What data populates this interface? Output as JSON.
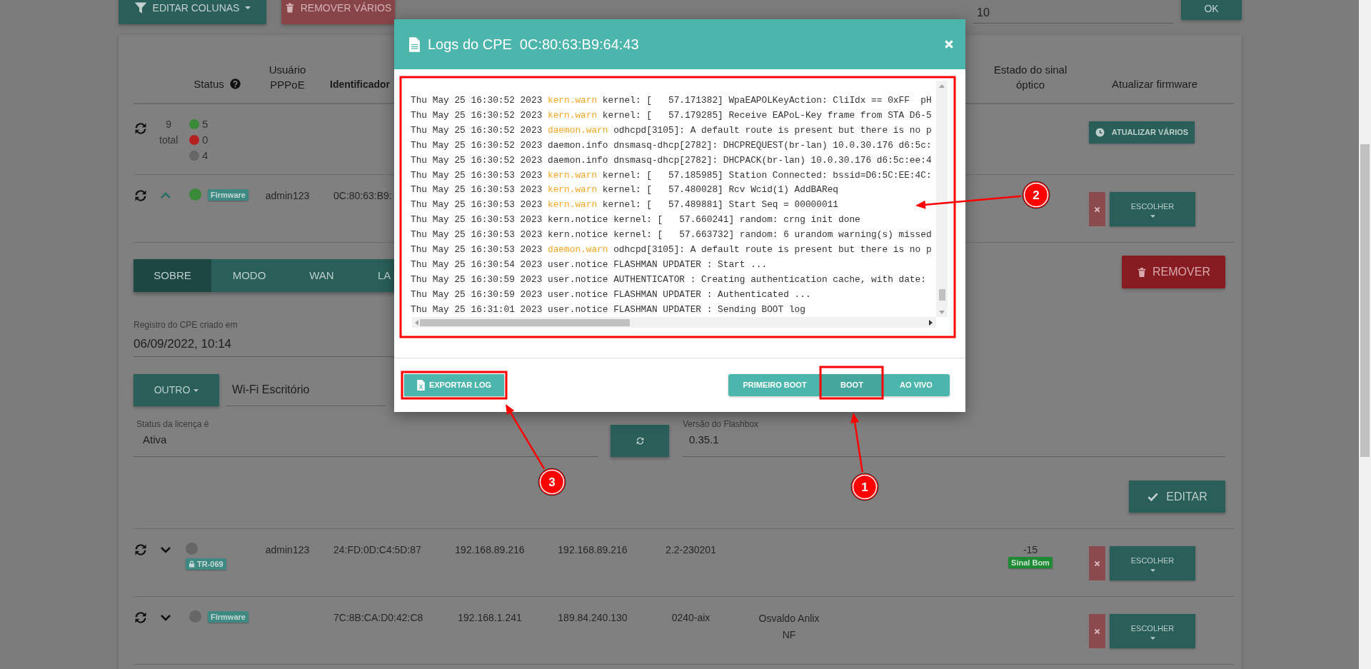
{
  "toolbar": {
    "columns_button": "EDITAR COLUNAS",
    "remove_many_button": "REMOVER VÁRIOS",
    "page_size": "10",
    "ok_button": "OK"
  },
  "table": {
    "header": {
      "status": "Status",
      "pppoe_user": "Usuário PPPoE",
      "identifier": "Identificador",
      "optical_signal": "Estado do sinal óptico",
      "firmware_update": "Atualizar firmware"
    },
    "summary": {
      "total": "9",
      "total_label": "total",
      "counts": [
        {
          "color": "#3a8a3a",
          "count": "5"
        },
        {
          "color": "#b32020",
          "count": "0"
        },
        {
          "color": "#666666",
          "count": "4"
        }
      ],
      "update_many_button": "ATUALIZAR VÁRIOS"
    },
    "rows": [
      {
        "expanded": true,
        "color": "#3a8a3a",
        "badge": {
          "kind": "firmware",
          "label": "Firmware"
        },
        "pppoe_user": "admin123",
        "identifier": "0C:80:63:B9:",
        "action_button": "ESCOLHER",
        "details": {
          "tabs": [
            {
              "label": "SOBRE",
              "selected": true
            },
            {
              "label": "MODO",
              "selected": false
            },
            {
              "label": "WAN",
              "selected": false
            },
            {
              "label": "LA",
              "selected": false
            }
          ],
          "remove_button": "REMOVER",
          "created_label": "Registro do CPE criado em",
          "created_value": "06/09/2022, 10:14",
          "mode_button": "OUTRO",
          "wifi_name": "Wi-Fi Escritório",
          "license_label": "Status da licença é",
          "license_value": "Ativa",
          "flashbox_label": "Versão do Flashbox",
          "flashbox_value": "0.35.1",
          "edit_button": "EDITAR"
        }
      },
      {
        "expanded": false,
        "color": "#666666",
        "badge": {
          "kind": "tr069",
          "label": "TR-069"
        },
        "pppoe_user": "admin123",
        "identifier": "24:FD:0D:C4:5D:87",
        "ip": "192.168.89.216",
        "wan_ip": "192.168.89.216",
        "firmware": "2.2-230201",
        "signal": "-15",
        "signal_badge": "Sinal Bom",
        "action_button": "ESCOLHER"
      },
      {
        "expanded": false,
        "color": "#666666",
        "badge": {
          "kind": "firmware",
          "label": "Firmware"
        },
        "identifier": "7C:8B:CA:D0:42:C8",
        "ip": "192.168.1.241",
        "wan_ip": "189.84.240.130",
        "firmware": "0240-aix",
        "name": "Osvaldo Anlix NF",
        "action_button": "ESCOLHER"
      }
    ]
  },
  "modal": {
    "title": "Logs do CPE",
    "mac": "0C:80:63:B9:64:43",
    "lines": [
      {
        "time": "Thu May 25 16:30:52 2023",
        "facility": "kern.warn",
        "message": "kernel: [   57.171382] WpaEAPOLKeyAction: CliIdx == 0xFF  pH",
        "warning": true
      },
      {
        "time": "Thu May 25 16:30:52 2023",
        "facility": "kern.warn",
        "message": "kernel: [   57.179285] Receive EAPoL-Key frame from STA D6-5",
        "warning": true
      },
      {
        "time": "Thu May 25 16:30:52 2023",
        "facility": "daemon.warn",
        "message": "odhcpd[3105]: A default route is present but there is no p",
        "warning": true
      },
      {
        "time": "Thu May 25 16:30:52 2023",
        "facility": "daemon.info",
        "message": "dnsmasq-dhcp[2782]: DHCPREQUEST(br-lan) 10.0.30.176 d6:5c:",
        "warning": false
      },
      {
        "time": "Thu May 25 16:30:52 2023",
        "facility": "daemon.info",
        "message": "dnsmasq-dhcp[2782]: DHCPACK(br-lan) 10.0.30.176 d6:5c:ee:4",
        "warning": false
      },
      {
        "time": "Thu May 25 16:30:53 2023",
        "facility": "kern.warn",
        "message": "kernel: [   57.185985] Station Connected: bssid=D6:5C:EE:4C:",
        "warning": true
      },
      {
        "time": "Thu May 25 16:30:53 2023",
        "facility": "kern.warn",
        "message": "kernel: [   57.480028] Rcv Wcid(1) AddBAReq",
        "warning": true
      },
      {
        "time": "Thu May 25 16:30:53 2023",
        "facility": "kern.warn",
        "message": "kernel: [   57.489881] Start Seq = 00000011",
        "warning": true
      },
      {
        "time": "Thu May 25 16:30:53 2023",
        "facility": "kern.notice",
        "message": "kernel: [   57.660241] random: crng init done",
        "warning": false
      },
      {
        "time": "Thu May 25 16:30:53 2023",
        "facility": "kern.notice",
        "message": "kernel: [   57.663732] random: 6 urandom warning(s) missed",
        "warning": false
      },
      {
        "time": "Thu May 25 16:30:53 2023",
        "facility": "daemon.warn",
        "message": "odhcpd[3105]: A default route is present but there is no p",
        "warning": true
      },
      {
        "time": "Thu May 25 16:30:54 2023",
        "facility": "user.notice",
        "message": "FLASHMAN UPDATER : Start ...",
        "warning": false
      },
      {
        "time": "Thu May 25 16:30:59 2023",
        "facility": "user.notice",
        "message": "AUTHENTICATOR : Creating authentication cache, with date:",
        "warning": false
      },
      {
        "time": "Thu May 25 16:30:59 2023",
        "facility": "user.notice",
        "message": "FLASHMAN UPDATER : Authenticated ...",
        "warning": false
      },
      {
        "time": "Thu May 25 16:31:01 2023",
        "facility": "user.notice",
        "message": "FLASHMAN UPDATER : Sending BOOT log",
        "warning": false
      }
    ],
    "export_button": "EXPORTAR LOG",
    "modes": [
      {
        "label": "PRIMEIRO BOOT",
        "selected": false
      },
      {
        "label": "BOOT",
        "selected": true
      },
      {
        "label": "AO VIVO",
        "selected": false
      }
    ]
  },
  "annotations": [
    {
      "number": "1"
    },
    {
      "number": "2"
    },
    {
      "number": "3"
    }
  ]
}
